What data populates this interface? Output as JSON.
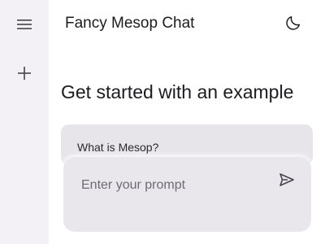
{
  "sidebar": {
    "menu_icon": "menu-icon",
    "add_icon": "add-icon"
  },
  "header": {
    "title": "Fancy Mesop Chat",
    "theme_icon": "moon-icon"
  },
  "main": {
    "heading": "Get started with an example",
    "examples": [
      {
        "label": "What is Mesop?"
      }
    ]
  },
  "prompt": {
    "placeholder": "Enter your prompt",
    "value": "",
    "send_icon": "send-icon"
  },
  "colors": {
    "sidebar_bg": "#f3f1f5",
    "card_bg": "#e7e5ea",
    "prompt_bg": "#e9e7ec",
    "text": "#1c1b1f"
  }
}
